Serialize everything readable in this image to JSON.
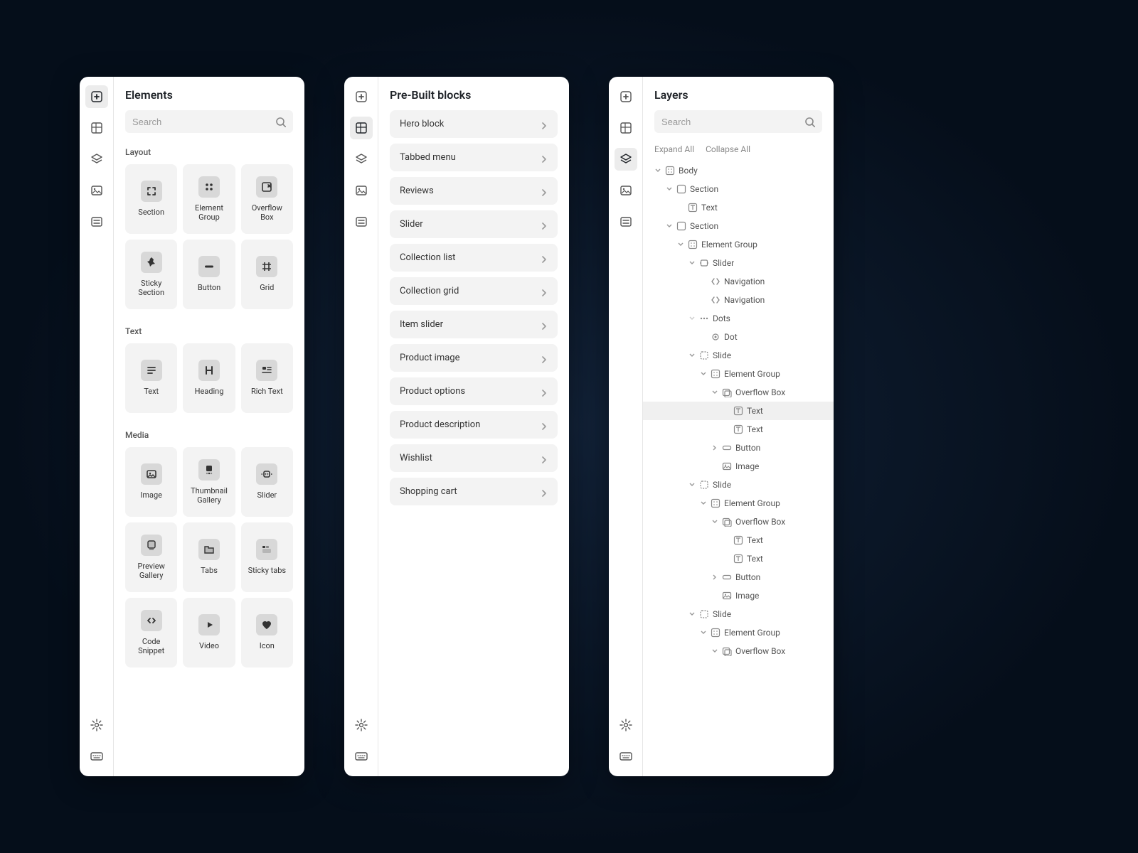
{
  "elements_panel": {
    "title": "Elements",
    "search_placeholder": "Search",
    "sections": {
      "layout": {
        "label": "Layout",
        "items": [
          {
            "label": "Section",
            "icon": "section"
          },
          {
            "label": "Element Group",
            "icon": "group"
          },
          {
            "label": "Overflow Box",
            "icon": "overflow"
          },
          {
            "label": "Sticky Section",
            "icon": "pin"
          },
          {
            "label": "Button",
            "icon": "button"
          },
          {
            "label": "Grid",
            "icon": "grid"
          }
        ]
      },
      "text": {
        "label": "Text",
        "items": [
          {
            "label": "Text",
            "icon": "text"
          },
          {
            "label": "Heading",
            "icon": "heading"
          },
          {
            "label": "Rich Text",
            "icon": "richtext"
          }
        ]
      },
      "media": {
        "label": "Media",
        "items": [
          {
            "label": "Image",
            "icon": "image"
          },
          {
            "label": "Thumbnail Gallery",
            "icon": "thumbs"
          },
          {
            "label": "Slider",
            "icon": "slider"
          },
          {
            "label": "Preview Gallery",
            "icon": "preview"
          },
          {
            "label": "Tabs",
            "icon": "tabs"
          },
          {
            "label": "Sticky tabs",
            "icon": "stickytabs"
          },
          {
            "label": "Code Snippet",
            "icon": "code"
          },
          {
            "label": "Video",
            "icon": "video"
          },
          {
            "label": "Icon",
            "icon": "heart"
          }
        ]
      }
    }
  },
  "blocks_panel": {
    "title": "Pre-Built blocks",
    "items": [
      {
        "label": "Hero block"
      },
      {
        "label": "Tabbed menu"
      },
      {
        "label": "Reviews"
      },
      {
        "label": "Slider"
      },
      {
        "label": "Collection list"
      },
      {
        "label": "Collection grid"
      },
      {
        "label": "Item slider"
      },
      {
        "label": "Product image"
      },
      {
        "label": "Product options"
      },
      {
        "label": "Product description"
      },
      {
        "label": "Wishlist"
      },
      {
        "label": "Shopping cart"
      }
    ]
  },
  "layers_panel": {
    "title": "Layers",
    "search_placeholder": "Search",
    "expand_label": "Expand All",
    "collapse_label": "Collapse All",
    "tree": [
      {
        "depth": 0,
        "toggle": "open",
        "icon": "body",
        "label": "Body"
      },
      {
        "depth": 1,
        "toggle": "open",
        "icon": "section",
        "label": "Section"
      },
      {
        "depth": 2,
        "toggle": "none",
        "icon": "text",
        "label": "Text"
      },
      {
        "depth": 1,
        "toggle": "open",
        "icon": "section",
        "label": "Section"
      },
      {
        "depth": 2,
        "toggle": "open",
        "icon": "group",
        "label": "Element Group"
      },
      {
        "depth": 3,
        "toggle": "open",
        "icon": "slider",
        "label": "Slider"
      },
      {
        "depth": 4,
        "toggle": "none",
        "icon": "nav",
        "label": "Navigation"
      },
      {
        "depth": 4,
        "toggle": "none",
        "icon": "nav",
        "label": "Navigation"
      },
      {
        "depth": 3,
        "toggle": "open-dim",
        "icon": "dots",
        "label": "Dots"
      },
      {
        "depth": 4,
        "toggle": "none",
        "icon": "dot",
        "label": "Dot"
      },
      {
        "depth": 3,
        "toggle": "open",
        "icon": "slide",
        "label": "Slide"
      },
      {
        "depth": 4,
        "toggle": "open",
        "icon": "group",
        "label": "Element Group"
      },
      {
        "depth": 5,
        "toggle": "open",
        "icon": "overflow",
        "label": "Overflow Box"
      },
      {
        "depth": 6,
        "toggle": "none",
        "icon": "text",
        "label": "Text",
        "selected": true
      },
      {
        "depth": 6,
        "toggle": "none",
        "icon": "text",
        "label": "Text"
      },
      {
        "depth": 5,
        "toggle": "closed",
        "icon": "button",
        "label": "Button"
      },
      {
        "depth": 5,
        "toggle": "none",
        "icon": "image",
        "label": "Image"
      },
      {
        "depth": 3,
        "toggle": "open",
        "icon": "slide",
        "label": "Slide"
      },
      {
        "depth": 4,
        "toggle": "open",
        "icon": "group",
        "label": "Element Group"
      },
      {
        "depth": 5,
        "toggle": "open",
        "icon": "overflow",
        "label": "Overflow Box"
      },
      {
        "depth": 6,
        "toggle": "none",
        "icon": "text",
        "label": "Text"
      },
      {
        "depth": 6,
        "toggle": "none",
        "icon": "text",
        "label": "Text"
      },
      {
        "depth": 5,
        "toggle": "closed",
        "icon": "button",
        "label": "Button"
      },
      {
        "depth": 5,
        "toggle": "none",
        "icon": "image",
        "label": "Image"
      },
      {
        "depth": 3,
        "toggle": "open",
        "icon": "slide",
        "label": "Slide"
      },
      {
        "depth": 4,
        "toggle": "open",
        "icon": "group",
        "label": "Element Group"
      },
      {
        "depth": 5,
        "toggle": "open",
        "icon": "overflow",
        "label": "Overflow Box"
      }
    ]
  }
}
